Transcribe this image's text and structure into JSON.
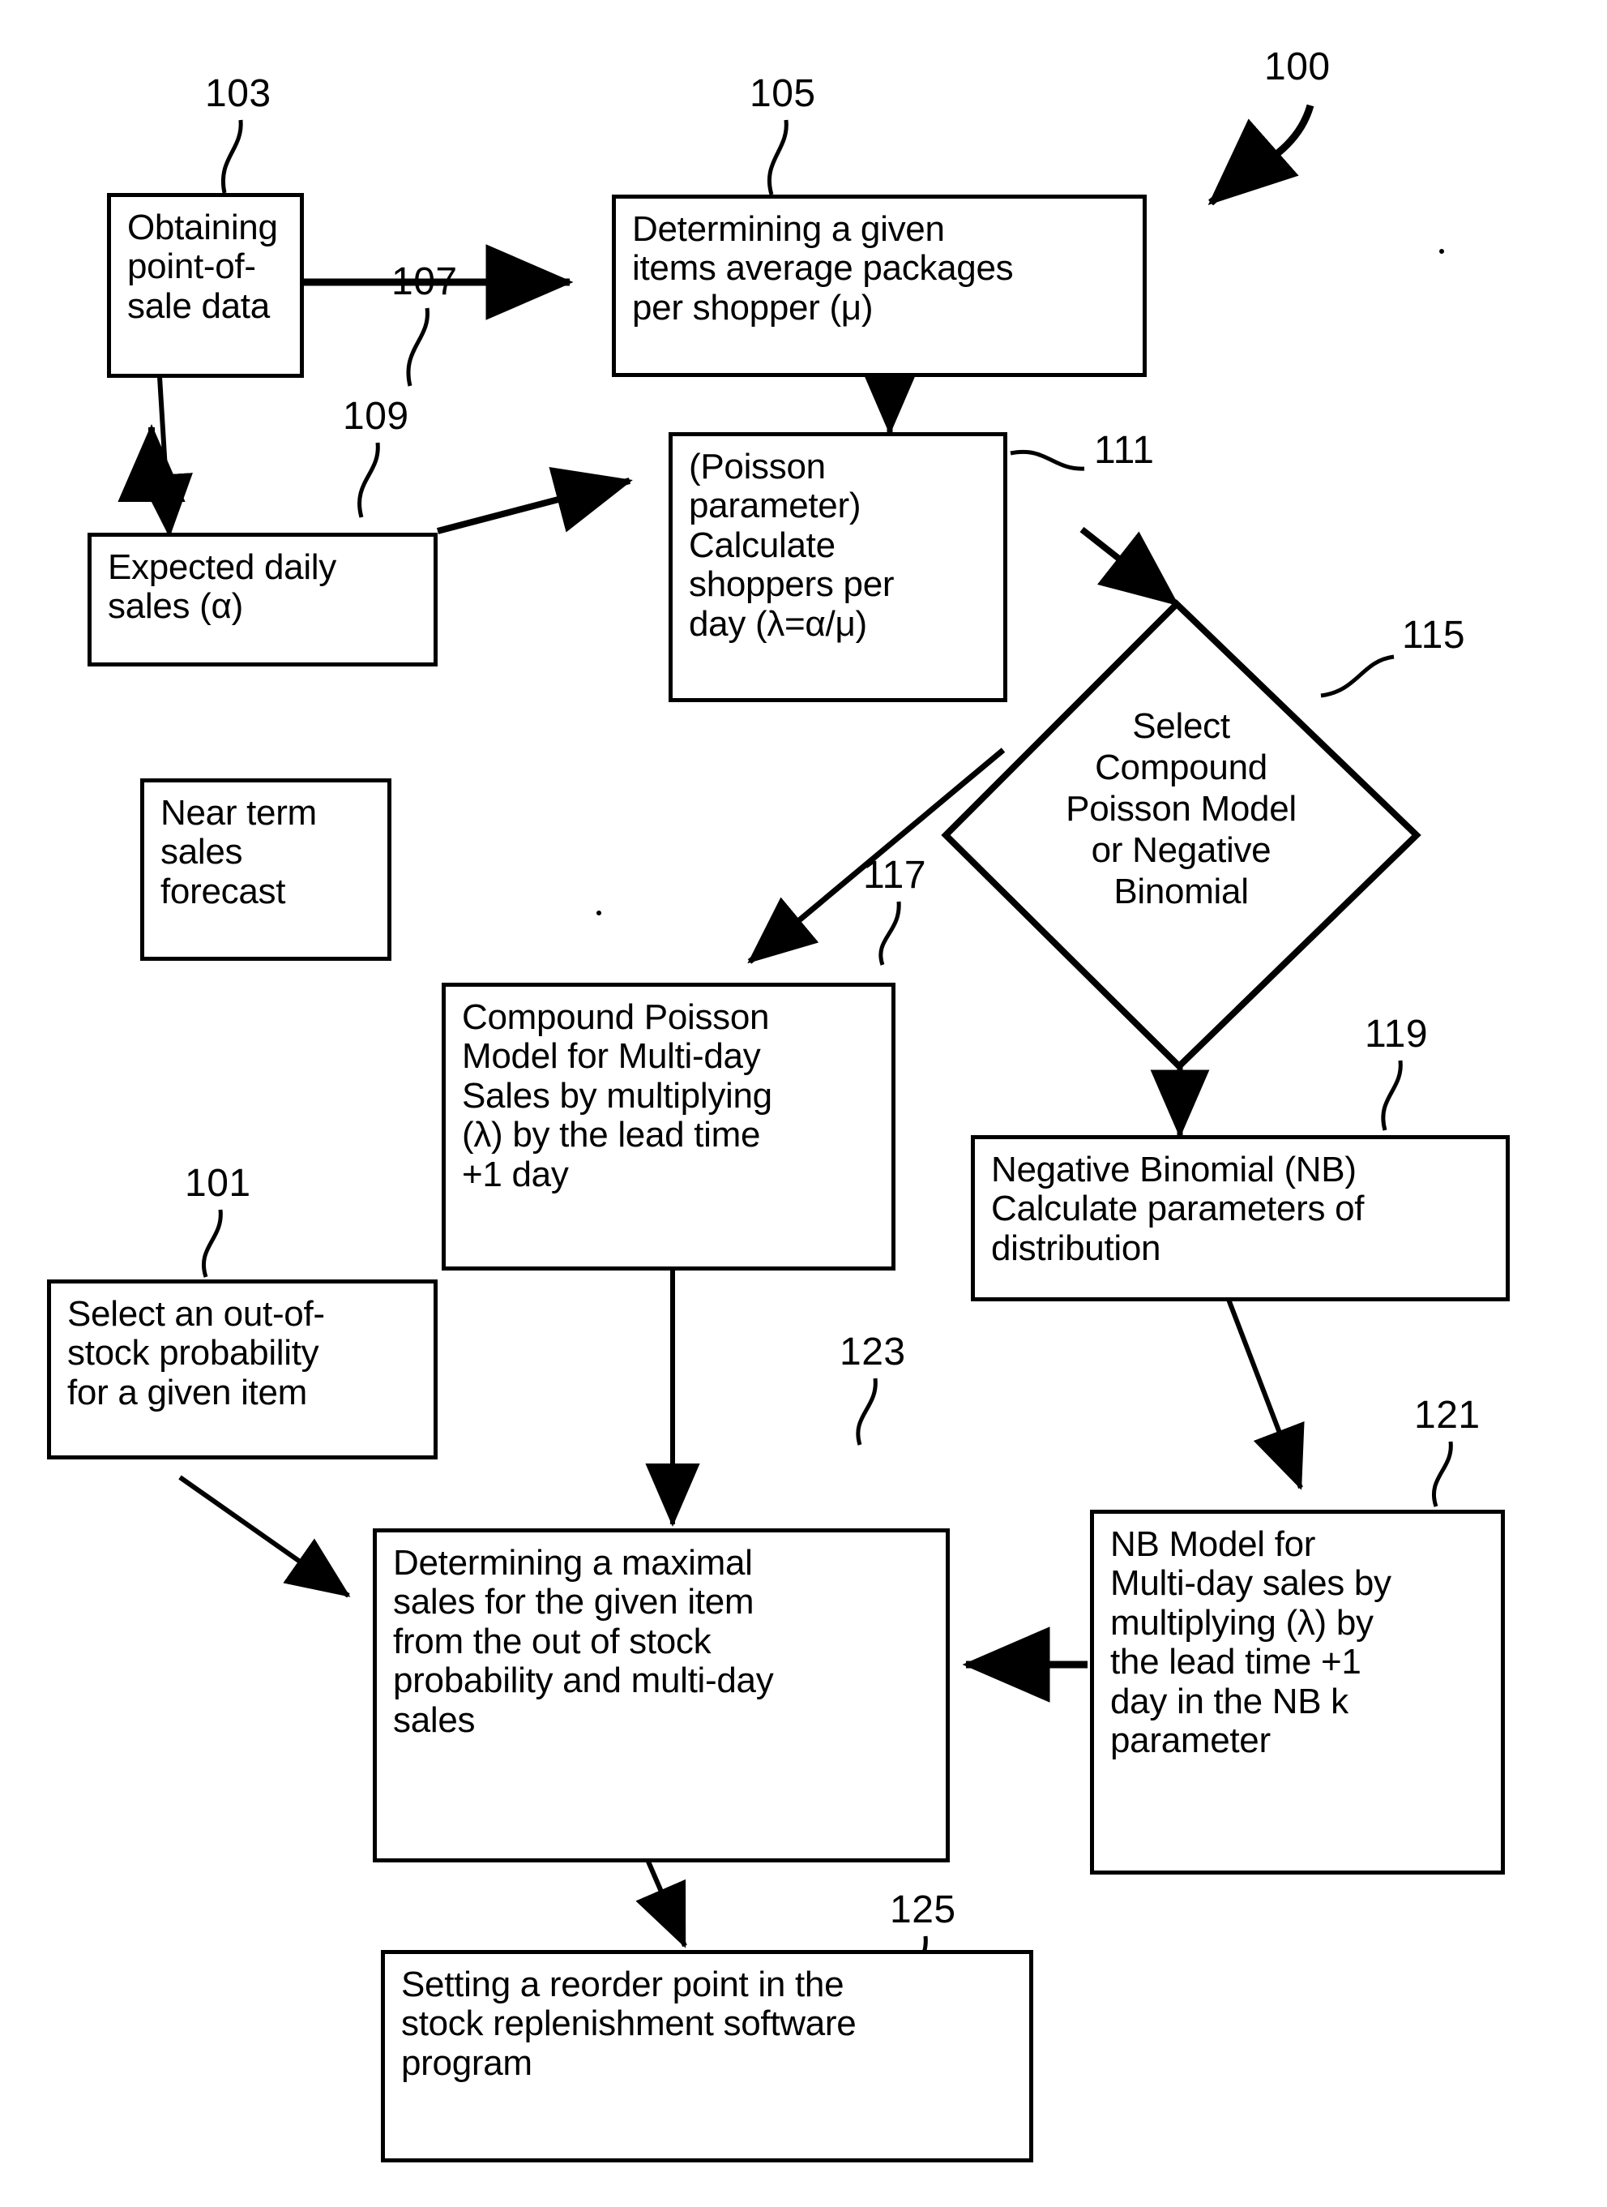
{
  "figure": {
    "figure_number": "100",
    "nodes": [
      {
        "id": "103",
        "ref": "103",
        "shape": "rect",
        "text": "Obtaining\npoint-of-\nsale data"
      },
      {
        "id": "105",
        "ref": "105",
        "shape": "rect",
        "text": "Determining a given\nitems average packages\nper shopper (μ)"
      },
      {
        "id": "107",
        "ref": "107",
        "shape": "rect",
        "text": "Expected daily\nsales (α)"
      },
      {
        "id": "109",
        "ref": "109",
        "shape": "rect",
        "text": "Near term\nsales\nforecast"
      },
      {
        "id": "111",
        "ref": "111",
        "shape": "rect",
        "text": "(Poisson\nparameter)\nCalculate\nshoppers per\nday (λ=α/μ)"
      },
      {
        "id": "115",
        "ref": "115",
        "shape": "diamond",
        "text": "Select\nCompound\nPoisson Model\nor Negative\nBinomial"
      },
      {
        "id": "117",
        "ref": "117",
        "shape": "rect",
        "text": "Compound Poisson\nModel for Multi-day\nSales by multiplying\n(λ) by the lead time\n+1 day"
      },
      {
        "id": "119",
        "ref": "119",
        "shape": "rect",
        "text": "Negative Binomial (NB)\nCalculate parameters of\ndistribution"
      },
      {
        "id": "101",
        "ref": "101",
        "shape": "rect",
        "text": "Select an out-of-\nstock probability\nfor a given item"
      },
      {
        "id": "121",
        "ref": "121",
        "shape": "rect",
        "text": "NB Model for\nMulti-day sales by\nmultiplying (λ) by\nthe lead time +1\nday in the NB k\nparameter"
      },
      {
        "id": "123",
        "ref": "123",
        "shape": "rect",
        "text": "Determining a maximal\nsales for the given item\nfrom the out of stock\nprobability and multi-day\nsales"
      },
      {
        "id": "125",
        "ref": "125",
        "shape": "rect",
        "text": "Setting a reorder point in the\nstock replenishment software\nprogram"
      }
    ],
    "edges": [
      {
        "from": "103",
        "to": "105"
      },
      {
        "from": "103",
        "to": "107"
      },
      {
        "from": "105",
        "to": "111"
      },
      {
        "from": "107",
        "to": "111"
      },
      {
        "from": "109",
        "to": "107"
      },
      {
        "from": "111",
        "to": "115"
      },
      {
        "from": "115",
        "to": "117"
      },
      {
        "from": "115",
        "to": "119"
      },
      {
        "from": "117",
        "to": "123"
      },
      {
        "from": "119",
        "to": "121"
      },
      {
        "from": "121",
        "to": "123"
      },
      {
        "from": "101",
        "to": "123"
      },
      {
        "from": "123",
        "to": "125"
      }
    ],
    "colors": {
      "ink": "#000000",
      "paper": "#ffffff"
    }
  }
}
